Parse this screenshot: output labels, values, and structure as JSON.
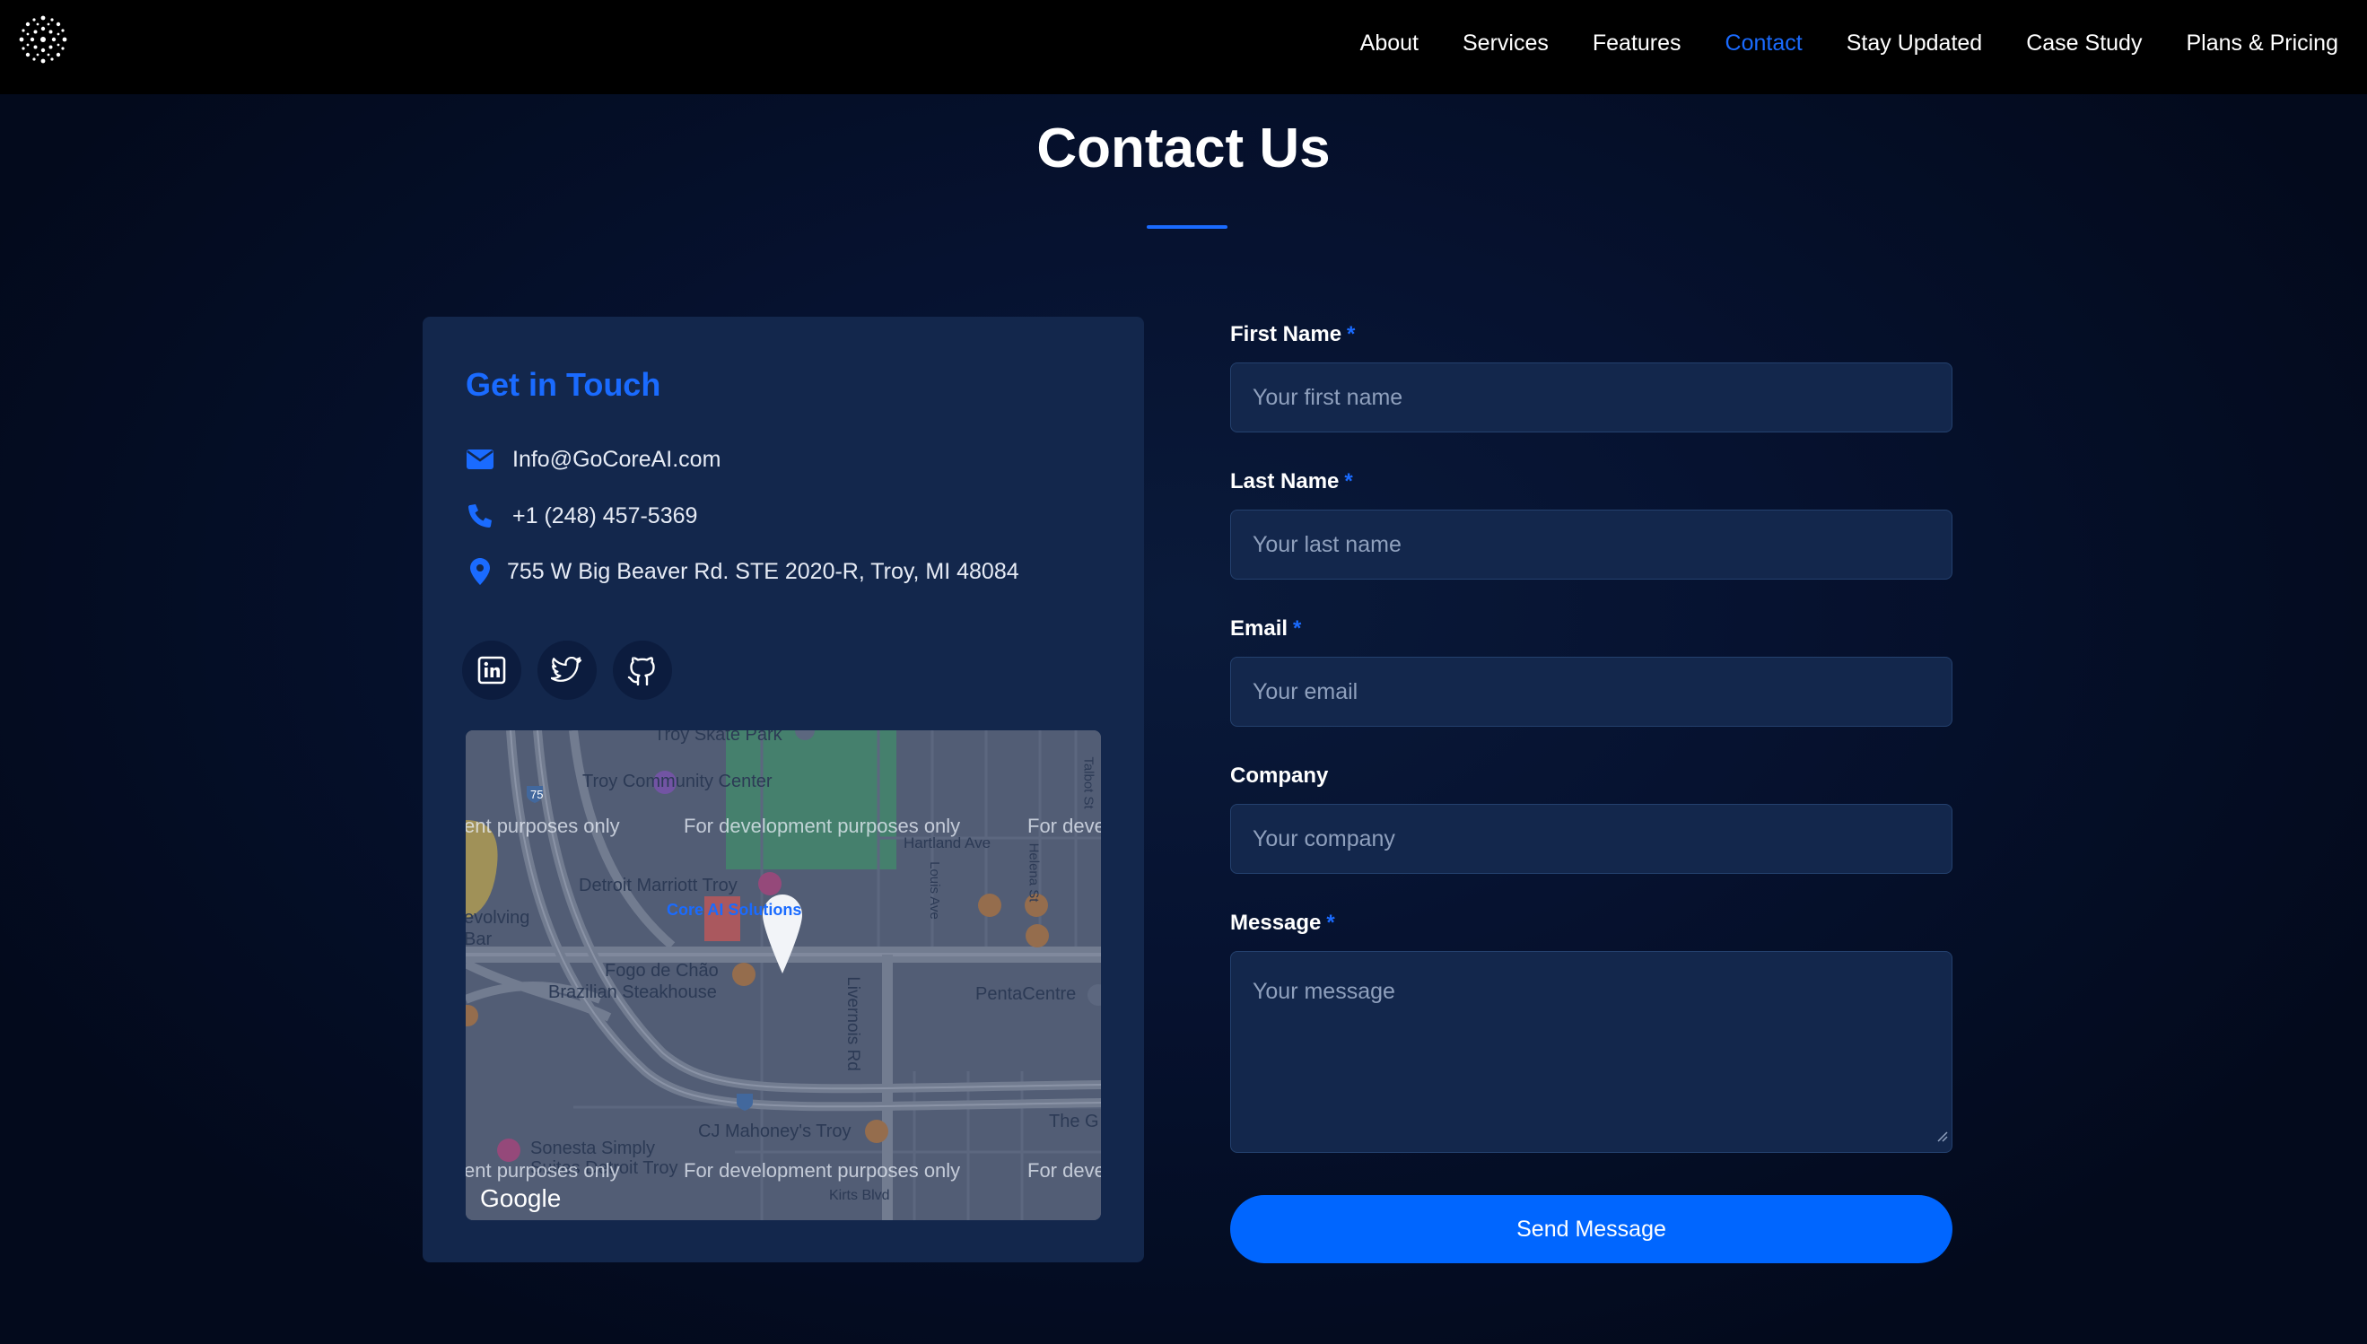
{
  "nav": {
    "logo_icon": "dotted-burst-logo",
    "links": [
      {
        "label": "About",
        "active": false
      },
      {
        "label": "Services",
        "active": false
      },
      {
        "label": "Features",
        "active": false
      },
      {
        "label": "Contact",
        "active": true
      },
      {
        "label": "Stay Updated",
        "active": false
      },
      {
        "label": "Case Study",
        "active": false
      },
      {
        "label": "Plans & Pricing",
        "active": false
      }
    ]
  },
  "page": {
    "title": "Contact Us",
    "accent_color": "#1a6bff"
  },
  "contact_card": {
    "heading": "Get in Touch",
    "email": "Info@GoCoreAI.com",
    "phone": "+1 (248) 457-5369",
    "address": "755 W Big Beaver Rd. STE 2020-R, Troy, MI 48084",
    "socials": [
      "linkedin-icon",
      "twitter-icon",
      "github-icon"
    ],
    "map": {
      "watermark": "For development purposes only",
      "watermark_left": "ent purposes only",
      "watermark_right": "For deve",
      "pin_label": "Core AI Solutions",
      "provider": "Google",
      "places": {
        "skate_park": "Troy Skate Park",
        "community_center": "Troy Community Center",
        "marriott": "Detroit Marriott Troy",
        "hartland": "Hartland Ave",
        "revolving_1": "evolving",
        "revolving_2": "Bar",
        "fogo_1": "Fogo de Chão",
        "fogo_2": "Brazilian Steakhouse",
        "livernois": "Livernois Rd",
        "pentacentre": "PentaCentre",
        "louis": "Louis Ave",
        "helena": "Helena St",
        "talbot": "Talbot St",
        "mahoneys": "CJ Mahoney's Troy",
        "sonesta_1": "Sonesta Simply",
        "sonesta_2": "Suites Detroit Troy",
        "the_g": "The G",
        "kirts": "Kirts Blvd",
        "hw75": "75"
      }
    }
  },
  "form": {
    "fields": {
      "first_name": {
        "label": "First Name",
        "required": "*",
        "placeholder": "Your first name"
      },
      "last_name": {
        "label": "Last Name",
        "required": "*",
        "placeholder": "Your last name"
      },
      "email": {
        "label": "Email",
        "required": "*",
        "placeholder": "Your email"
      },
      "company": {
        "label": "Company",
        "placeholder": "Your company"
      },
      "message": {
        "label": "Message",
        "required": "*",
        "placeholder": "Your message"
      }
    },
    "submit_label": "Send Message"
  }
}
